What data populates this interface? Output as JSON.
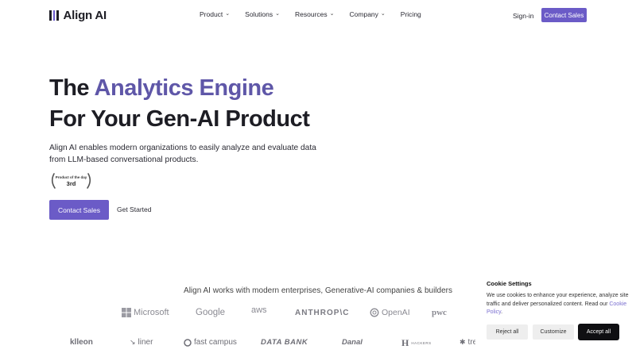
{
  "header": {
    "logo_text": "Align AI",
    "logo_icon": "bars-logo-icon",
    "nav": [
      {
        "label": "Product",
        "has_dropdown": true
      },
      {
        "label": "Solutions",
        "has_dropdown": true
      },
      {
        "label": "Resources",
        "has_dropdown": true
      },
      {
        "label": "Company",
        "has_dropdown": true
      },
      {
        "label": "Pricing",
        "has_dropdown": false
      }
    ],
    "signin": "Sign-in",
    "contact": "Contact Sales"
  },
  "hero": {
    "line1_prefix": "The ",
    "line1_accent": "Analytics Engine",
    "line2": "For Your Gen-AI Product",
    "description": "Align AI enables modern organizations to easily analyze and evaluate data from LLM-based conversational products.",
    "badge_top": "Product of the day",
    "badge_rank": "3rd",
    "cta_primary": "Contact Sales",
    "cta_secondary": "Get Started"
  },
  "partners": {
    "title": "Align AI works with modern enterprises, Generative-AI companies & builders",
    "row1": [
      "Microsoft",
      "Google",
      "aws",
      "ANTHROP\\C",
      "OpenAI",
      "pwc"
    ],
    "row2": [
      "klleon",
      "liner",
      "fast campus",
      "DATA BANK",
      "Danal",
      "HACKERS",
      "tre"
    ]
  },
  "cookie": {
    "title": "Cookie Settings",
    "text": "We use cookies to enhance your experience, analyze site traffic and deliver personalized content. Read our ",
    "link": "Cookie Policy",
    "link_suffix": ".",
    "reject": "Reject all",
    "customize": "Customize",
    "accept": "Accept all"
  },
  "colors": {
    "accent": "#6b5bc7",
    "accent_text": "#5f57a8",
    "dark": "#0f0f12"
  }
}
